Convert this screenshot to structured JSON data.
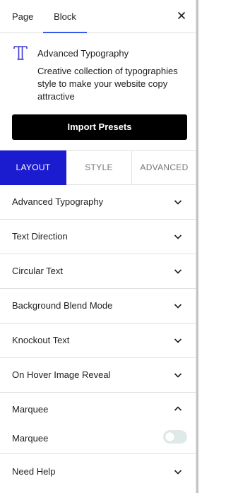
{
  "header": {
    "tabs": [
      {
        "label": "Page"
      },
      {
        "label": "Block"
      }
    ],
    "active_tab": "Block"
  },
  "block": {
    "icon": "typography-icon",
    "title": "Advanced Typography",
    "description": "Creative collection of typographies style to make your website copy attractive",
    "import_button": "Import Presets"
  },
  "inspector_tabs": [
    {
      "label": "LAYOUT",
      "active": true
    },
    {
      "label": "STYLE",
      "active": false
    },
    {
      "label": "ADVANCED",
      "active": false
    }
  ],
  "sections": [
    {
      "label": "Advanced Typography",
      "expanded": false
    },
    {
      "label": "Text Direction",
      "expanded": false
    },
    {
      "label": "Circular Text",
      "expanded": false
    },
    {
      "label": "Background Blend Mode",
      "expanded": false
    },
    {
      "label": "Knockout Text",
      "expanded": false
    },
    {
      "label": "On Hover Image Reveal",
      "expanded": false
    }
  ],
  "marquee": {
    "label": "Marquee",
    "expanded": true,
    "toggle_label": "Marquee",
    "toggle_on": false
  },
  "help": {
    "label": "Need Help",
    "expanded": false
  },
  "colors": {
    "accent": "#3858e9",
    "active_tab_bg": "#1b1bd0",
    "button_bg": "#000000"
  }
}
